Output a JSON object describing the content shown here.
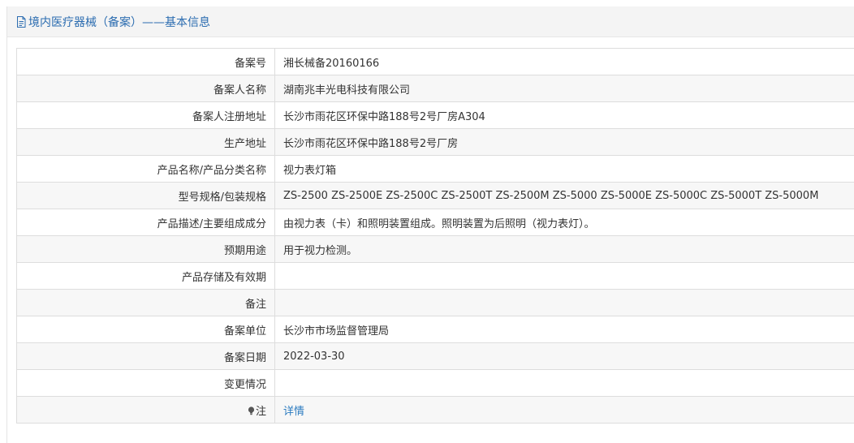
{
  "header": {
    "title": "境内医疗器械（备案）——基本信息",
    "icon": "document-icon",
    "title_color": "#2b6cb0"
  },
  "rows": [
    {
      "label": "备案号",
      "value": "湘长械备20160166"
    },
    {
      "label": "备案人名称",
      "value": "湖南兆丰光电科技有限公司"
    },
    {
      "label": "备案人注册地址",
      "value": "长沙市雨花区环保中路188号2号厂房A304"
    },
    {
      "label": "生产地址",
      "value": "长沙市雨花区环保中路188号2号厂房"
    },
    {
      "label": "产品名称/产品分类名称",
      "value": "视力表灯箱"
    },
    {
      "label": "型号规格/包装规格",
      "value": "ZS-2500 ZS-2500E ZS-2500C ZS-2500T ZS-2500M ZS-5000 ZS-5000E ZS-5000C ZS-5000T ZS-5000M"
    },
    {
      "label": "产品描述/主要组成成分",
      "value": "由视力表（卡）和照明装置组成。照明装置为后照明（视力表灯）。"
    },
    {
      "label": "预期用途",
      "value": "用于视力检测。"
    },
    {
      "label": "产品存储及有效期",
      "value": ""
    },
    {
      "label": "备注",
      "value": ""
    },
    {
      "label": "备案单位",
      "value": "长沙市市场监督管理局"
    },
    {
      "label": "备案日期",
      "value": "2022-03-30"
    },
    {
      "label": "变更情况",
      "value": ""
    }
  ],
  "note": {
    "label": "注",
    "icon": "lightbulb-icon",
    "link_text": "详情",
    "link_color": "#2b7bc0"
  }
}
